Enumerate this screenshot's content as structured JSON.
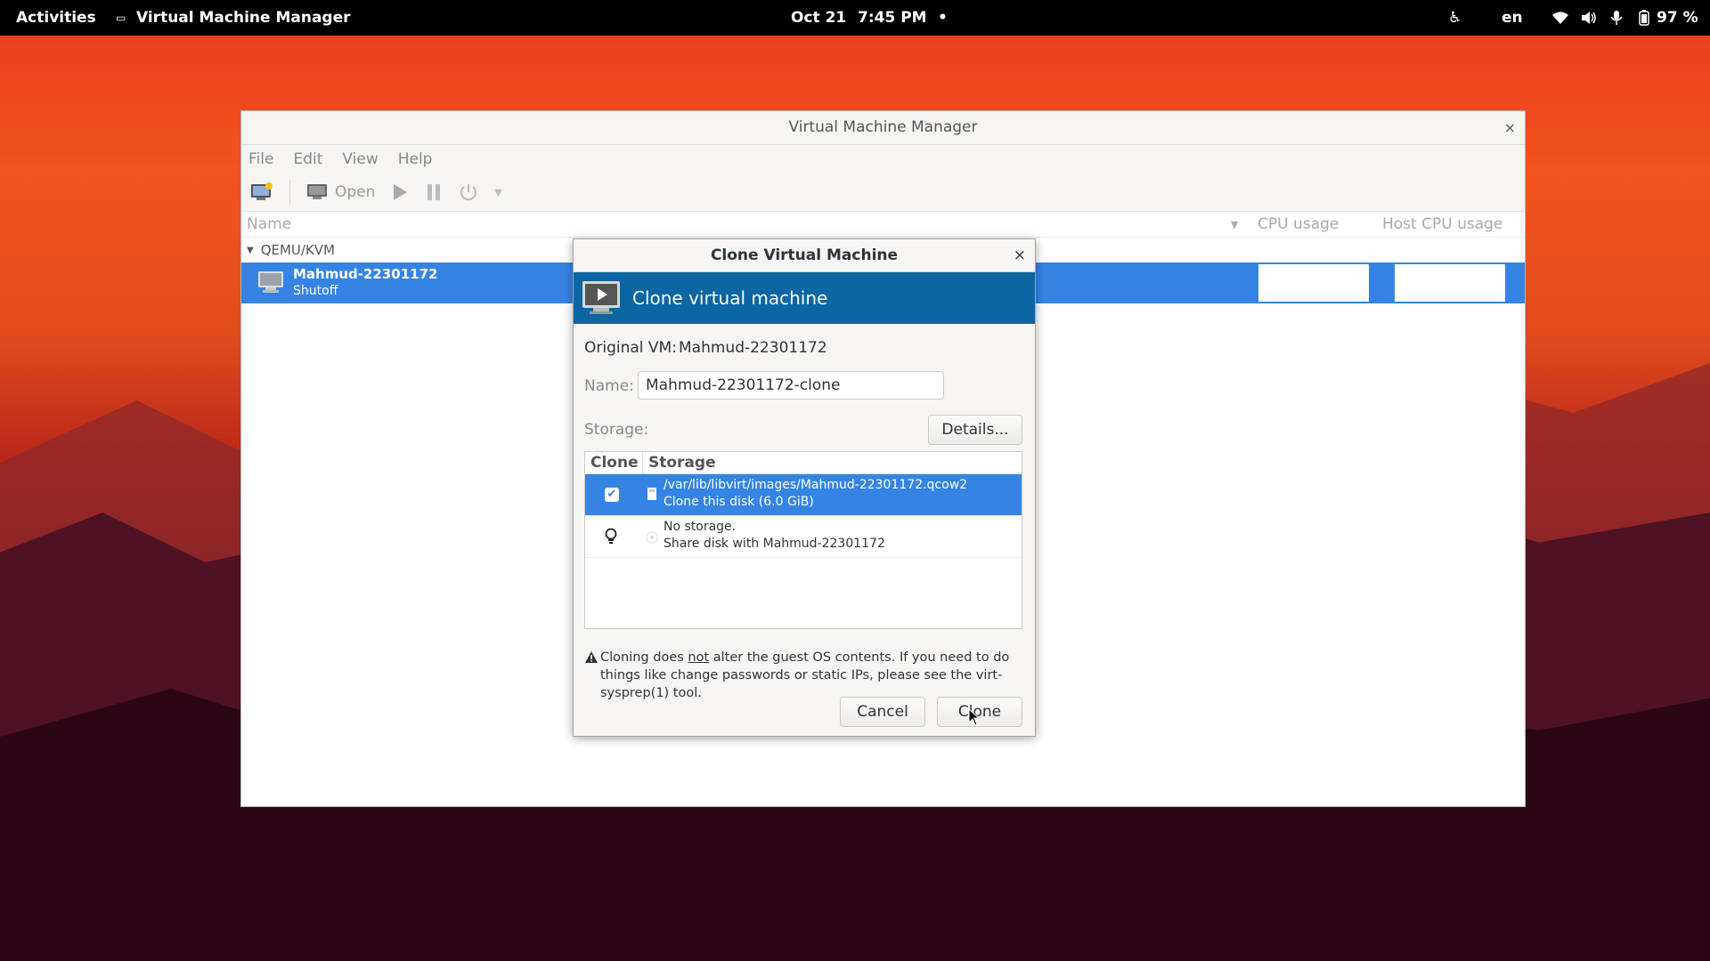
{
  "topbar": {
    "activities": "Activities",
    "app_name": "Virtual Machine Manager",
    "date": "Oct 21",
    "time": "7:45 PM",
    "lang": "en",
    "battery": "97 %"
  },
  "window": {
    "title": "Virtual Machine Manager",
    "menu": [
      "File",
      "Edit",
      "View",
      "Help"
    ],
    "toolbar": {
      "open_label": "Open"
    },
    "columns": {
      "name": "Name",
      "cpu": "CPU usage",
      "host_cpu": "Host CPU usage"
    },
    "group": "QEMU/KVM",
    "vm": {
      "name": "Mahmud-22301172",
      "status": "Shutoff"
    }
  },
  "dialog": {
    "title": "Clone Virtual Machine",
    "banner": "Clone virtual machine",
    "original_label": "Original VM:",
    "original_value": "Mahmud-22301172",
    "name_label": "Name:",
    "name_value": "Mahmud-22301172-clone",
    "storage_label": "Storage:",
    "details_button": "Details...",
    "table_headers": {
      "clone": "Clone",
      "storage": "Storage"
    },
    "rows": [
      {
        "line1": "/var/lib/libvirt/images/Mahmud-22301172.qcow2",
        "line2": "Clone this disk (6.0 GiB)"
      },
      {
        "line1": "No storage.",
        "line2": "Share disk with Mahmud-22301172"
      }
    ],
    "warning_pre": "Cloning does ",
    "warning_not": "not",
    "warning_post": " alter the guest OS contents. If you need to do things like change passwords or static IPs, please see the virt-sysprep(1) tool.",
    "cancel_button": "Cancel",
    "clone_button": "Clone"
  },
  "colors": {
    "accent": "#3584e4",
    "banner": "#0b66a3"
  }
}
